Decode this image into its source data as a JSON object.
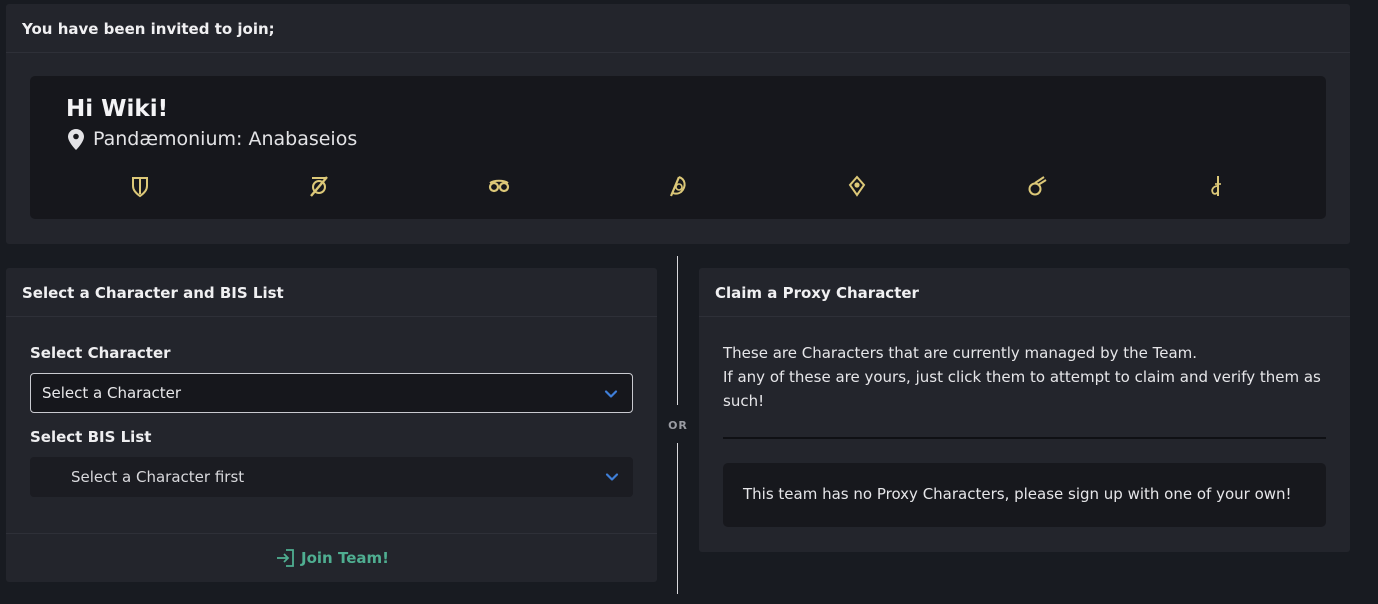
{
  "invite": {
    "header": "You have been invited to join;",
    "greeting": "Hi Wiki!",
    "location": "Pandæmonium: Anabaseios",
    "job_icons": [
      "paladin-icon",
      "dark-knight-icon",
      "scholar-icon",
      "reaper-icon",
      "sage-icon",
      "machinist-icon",
      "red-mage-icon"
    ]
  },
  "character_card": {
    "header": "Select a Character and BIS List",
    "character_label": "Select Character",
    "character_select_value": "Select a Character",
    "bis_label": "Select BIS List",
    "bis_select_value": "Select a Character first",
    "join_label": "Join Team!"
  },
  "divider": {
    "or_label": "OR"
  },
  "proxy_card": {
    "header": "Claim a Proxy Character",
    "description_line1": "These are Characters that are currently managed by the Team.",
    "description_line2": "If any of these are yours, just click them to attempt to claim and verify them as such!",
    "empty_message": "This team has no Proxy Characters, please sign up with one of your own!"
  },
  "colors": {
    "background": "#181b21",
    "card": "#23252c",
    "inner_box": "#16171c",
    "job_icon_gold": "#dcc878",
    "accent_blue": "#3f7fd9",
    "join_green": "#4fae91"
  }
}
